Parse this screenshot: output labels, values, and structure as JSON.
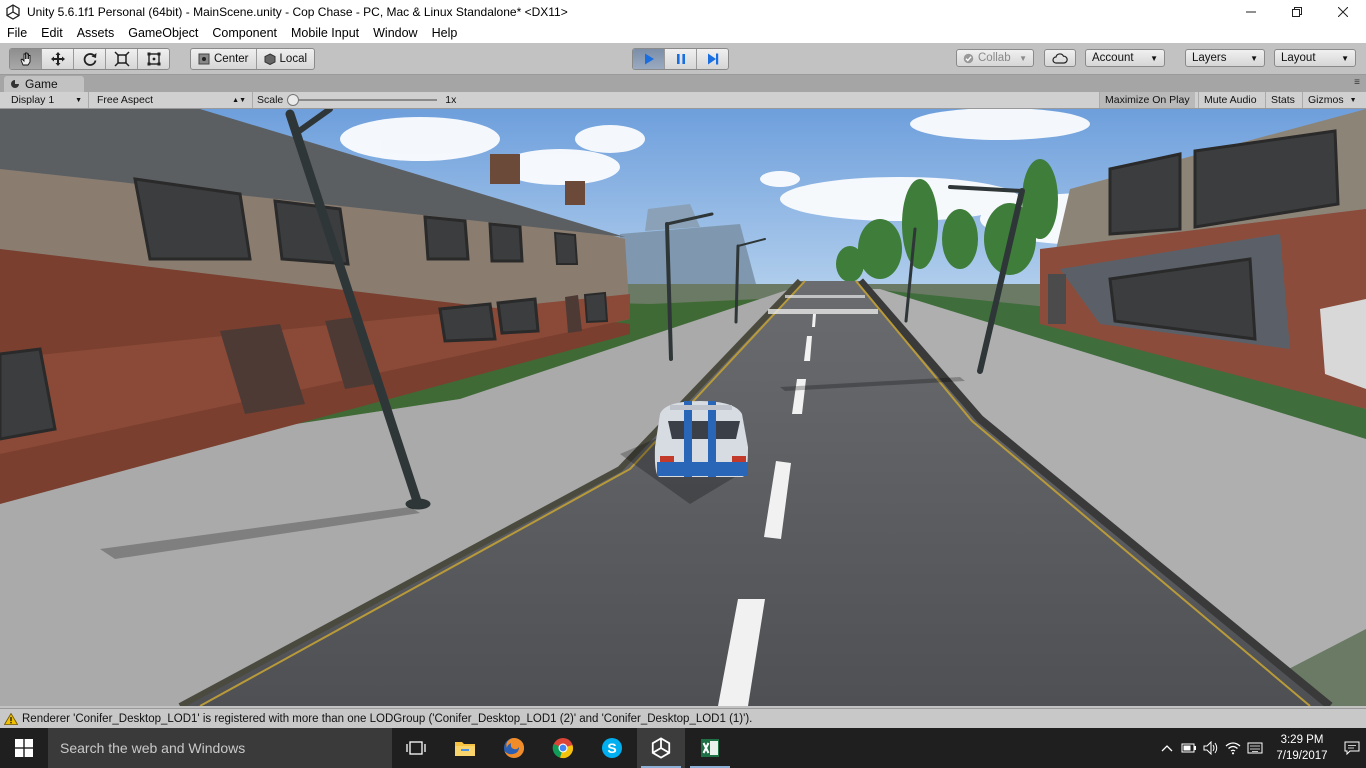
{
  "window": {
    "title": "Unity 5.6.1f1 Personal (64bit) - MainScene.unity - Cop Chase - PC, Mac & Linux Standalone* <DX11>"
  },
  "menu": [
    "File",
    "Edit",
    "Assets",
    "GameObject",
    "Component",
    "Mobile Input",
    "Window",
    "Help"
  ],
  "toolbar": {
    "pivot_label": "Center",
    "space_label": "Local",
    "collab_label": "Collab",
    "account_label": "Account",
    "layers_label": "Layers",
    "layout_label": "Layout"
  },
  "game_panel": {
    "tab_label": "Game",
    "display": "Display 1",
    "aspect": "Free Aspect",
    "scale_label": "Scale",
    "scale_value": "1x",
    "maximize_on_play": "Maximize On Play",
    "mute_audio": "Mute Audio",
    "stats": "Stats",
    "gizmos": "Gizmos"
  },
  "console": {
    "message": "Renderer 'Conifer_Desktop_LOD1' is registered with more than one LODGroup ('Conifer_Desktop_LOD1 (2)' and 'Conifer_Desktop_LOD1 (1)')."
  },
  "taskbar": {
    "search_placeholder": "Search the web and Windows",
    "time": "3:29 PM",
    "date": "7/19/2017",
    "apps": [
      "task-view",
      "file-explorer",
      "firefox",
      "chrome",
      "skype",
      "unity",
      "excel"
    ]
  },
  "colors": {
    "play_active": "#4a90e2",
    "taskbar_bg": "#1f1f1f",
    "editor_bg": "#c2c2c2",
    "warning": "#f0c000"
  }
}
